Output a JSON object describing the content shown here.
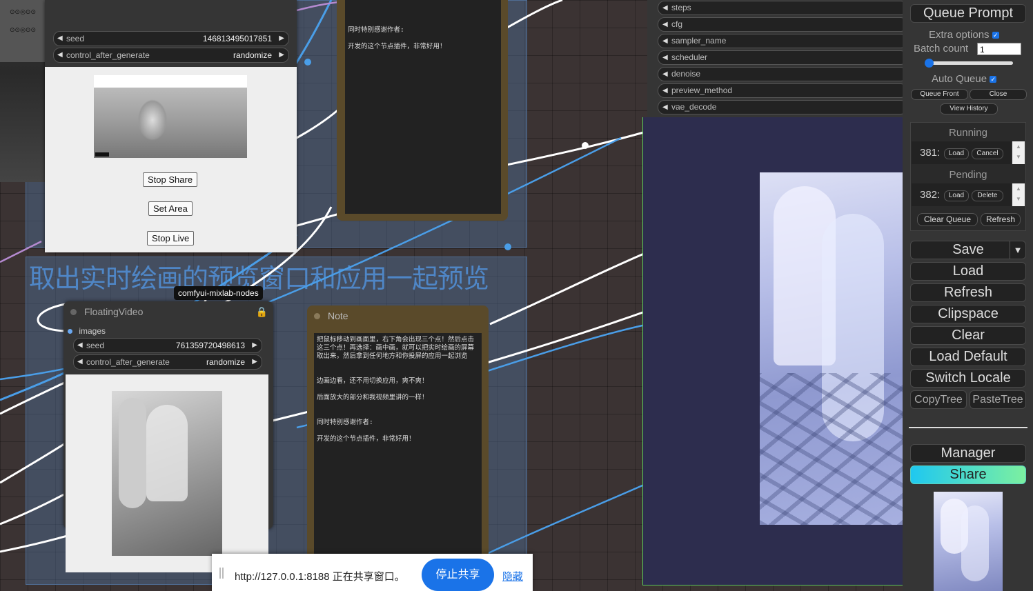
{
  "top_node": {
    "seed_label": "seed",
    "seed_value": "146813495017851",
    "cag_label": "control_after_generate",
    "cag_value": "randomize",
    "btn_stop_share": "Stop Share",
    "btn_set_area": "Set Area",
    "btn_stop_live": "Stop Live"
  },
  "group_title": "取出实时绘画的预览窗口和应用一起预览",
  "tooltip": "comfyui-mixlab-nodes",
  "floating_video": {
    "title": "FloatingVideo",
    "input_label": "images",
    "seed_label": "seed",
    "seed_value": "761359720498613",
    "cag_label": "control_after_generate",
    "cag_value": "randomize"
  },
  "note_top": {
    "text": "同时特别感谢作者:\n\n开发的这个节点插件，非常好用！"
  },
  "note": {
    "title": "Note",
    "text": "把鼠标移动到画面里，右下角会出现三个点！然后点击这三个点！再选择：画中画，就可以把实时绘画的屏幕取出来，然后拿到任何地方和你投屏的应用一起浏览\n\n\n边画边看，还不用切换应用，爽不爽！\n\n后面放大的部分和我视频里讲的一样！\n\n\n同时特别感谢作者:\n\n开发的这个节点插件，非常好用！"
  },
  "sampler_widgets": [
    "steps",
    "cfg",
    "sampler_name",
    "scheduler",
    "denoise",
    "preview_method",
    "vae_decode"
  ],
  "menu": {
    "queue_prompt": "Queue Prompt",
    "extra_options": "Extra options",
    "batch_count_label": "Batch count",
    "batch_count_value": "1",
    "auto_queue": "Auto Queue",
    "queue_front": "Queue Front",
    "close": "Close",
    "view_history": "View History",
    "running_title": "Running",
    "running_id": "381:",
    "running_load": "Load",
    "running_cancel": "Cancel",
    "pending_title": "Pending",
    "pending_id": "382:",
    "pending_load": "Load",
    "pending_delete": "Delete",
    "clear_queue": "Clear Queue",
    "refresh_small": "Refresh",
    "save": "Save",
    "save_arrow": "▼",
    "load": "Load",
    "refresh": "Refresh",
    "clipspace": "Clipspace",
    "clear": "Clear",
    "load_default": "Load Default",
    "switch_locale": "Switch Locale",
    "copy_tree": "CopyTree",
    "paste_tree": "PasteTree",
    "manager": "Manager",
    "share": "Share"
  },
  "share_bar": {
    "message": "http://127.0.0.1:8188 正在共享窗口。",
    "stop_button": "停止共享",
    "hide_link": "隐藏"
  },
  "colors": {
    "canvas_bg": "#3b3333",
    "menu_bg": "#353535",
    "share_gradient_start": "#1fc8f0",
    "share_gradient_end": "#7cf0a0",
    "chrome_blue": "#1a73e8"
  }
}
